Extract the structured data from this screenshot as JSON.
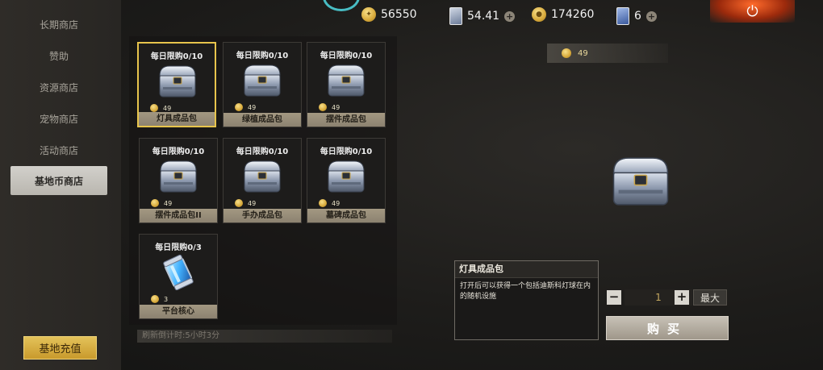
{
  "sidebar": {
    "items": [
      {
        "label": "长期商店",
        "active": false
      },
      {
        "label": "赞助",
        "active": false
      },
      {
        "label": "资源商店",
        "active": false
      },
      {
        "label": "宠物商店",
        "active": false
      },
      {
        "label": "活动商店",
        "active": false
      },
      {
        "label": "基地币商店",
        "active": true
      }
    ],
    "recharge_label": "基地充值"
  },
  "currencies": {
    "gold_coin": "56550",
    "card": "54.41",
    "base_coin": "174260",
    "ticket": "6"
  },
  "shop": {
    "items": [
      {
        "limit": "每日限购0/10",
        "price": "49",
        "name": "灯具成品包",
        "selected": true,
        "icon": "silver-chest-icon"
      },
      {
        "limit": "每日限购0/10",
        "price": "49",
        "name": "绿植成品包",
        "selected": false,
        "icon": "silver-chest-icon"
      },
      {
        "limit": "每日限购0/10",
        "price": "49",
        "name": "摆件成品包",
        "selected": false,
        "icon": "silver-chest-icon"
      },
      {
        "limit": "每日限购0/10",
        "price": "49",
        "name": "摆件成品包II",
        "selected": false,
        "icon": "silver-chest-icon"
      },
      {
        "limit": "每日限购0/10",
        "price": "49",
        "name": "手办成品包",
        "selected": false,
        "icon": "silver-chest-icon"
      },
      {
        "limit": "每日限购0/10",
        "price": "49",
        "name": "墓碑成品包",
        "selected": false,
        "icon": "silver-chest-icon"
      },
      {
        "limit": "每日限购0/3",
        "price": "3",
        "name": "平台核心",
        "selected": false,
        "icon": "blue-core-icon"
      }
    ],
    "refresh_text": "刷新倒计时:5小时3分"
  },
  "detail": {
    "price": "49",
    "title": "灯具成品包",
    "description": "打开后可以获得一个包括迪斯科灯球在内的随机设施",
    "quantity": "1",
    "max_label": "最大",
    "buy_label": "购买"
  },
  "colors": {
    "accent_gold": "#e7c44c",
    "power_red": "#c8401a",
    "dial_cyan": "#48bdc4"
  }
}
